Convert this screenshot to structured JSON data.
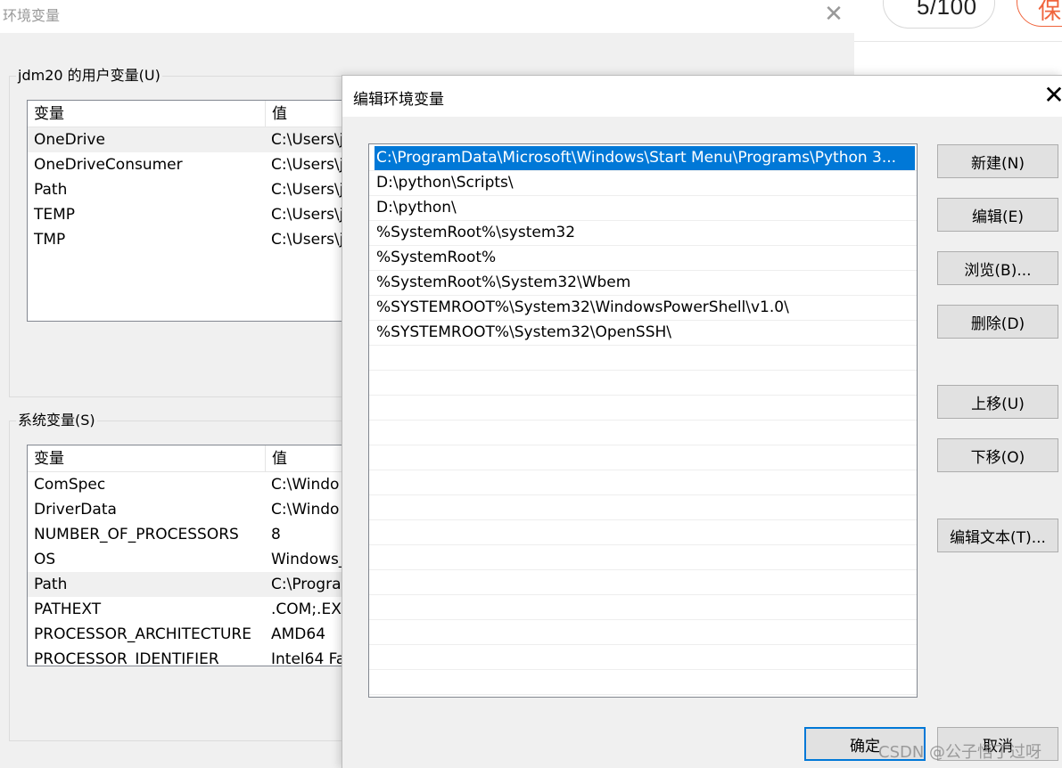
{
  "background_page": {
    "word_count": "5/100",
    "save_label": "保"
  },
  "env_window": {
    "title": "环境变量",
    "close_glyph": "✕",
    "user_vars": {
      "group_label": "jdm20 的用户变量(U)",
      "col_name": "变量",
      "col_value": "值",
      "rows": [
        {
          "name": "OneDrive",
          "value": "C:\\Users\\j"
        },
        {
          "name": "OneDriveConsumer",
          "value": "C:\\Users\\j"
        },
        {
          "name": "Path",
          "value": "C:\\Users\\j"
        },
        {
          "name": "TEMP",
          "value": "C:\\Users\\j"
        },
        {
          "name": "TMP",
          "value": "C:\\Users\\j"
        }
      ]
    },
    "system_vars": {
      "group_label": "系统变量(S)",
      "col_name": "变量",
      "col_value": "值",
      "rows": [
        {
          "name": "ComSpec",
          "value": "C:\\Windo"
        },
        {
          "name": "DriverData",
          "value": "C:\\Windo"
        },
        {
          "name": "NUMBER_OF_PROCESSORS",
          "value": "8"
        },
        {
          "name": "OS",
          "value": "Windows_"
        },
        {
          "name": "Path",
          "value": "C:\\Progra"
        },
        {
          "name": "PATHEXT",
          "value": ".COM;.EX"
        },
        {
          "name": "PROCESSOR_ARCHITECTURE",
          "value": "AMD64"
        },
        {
          "name": "PROCESSOR_IDENTIFIER",
          "value": "Intel64 Fa"
        }
      ]
    }
  },
  "edit_dialog": {
    "title": "编辑环境变量",
    "close_glyph": "✕",
    "paths": [
      "C:\\ProgramData\\Microsoft\\Windows\\Start Menu\\Programs\\Python 3...",
      "D:\\python\\Scripts\\",
      "D:\\python\\",
      "%SystemRoot%\\system32",
      "%SystemRoot%",
      "%SystemRoot%\\System32\\Wbem",
      "%SYSTEMROOT%\\System32\\WindowsPowerShell\\v1.0\\",
      "%SYSTEMROOT%\\System32\\OpenSSH\\"
    ],
    "buttons": {
      "new": "新建(N)",
      "edit": "编辑(E)",
      "browse": "浏览(B)...",
      "delete": "删除(D)",
      "move_up": "上移(U)",
      "move_down": "下移(O)",
      "edit_text": "编辑文本(T)...",
      "ok": "确定",
      "cancel": "取消"
    }
  },
  "watermark": "CSDN @公子悟丁过呀",
  "colors": {
    "selection": "#0078d7",
    "dialog_bg": "#f0f0f0",
    "accent_orange": "#f0643c"
  }
}
